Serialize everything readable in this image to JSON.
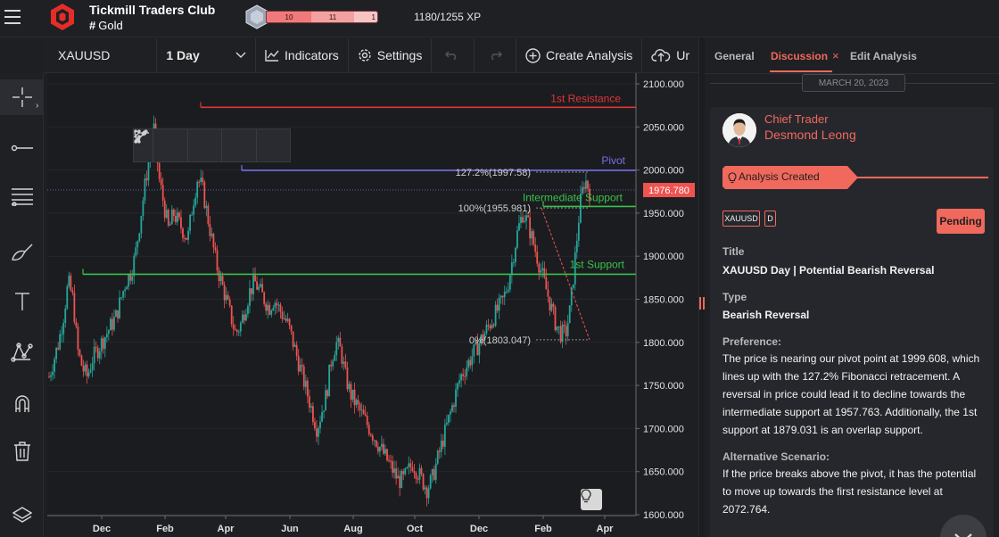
{
  "header": {
    "club_title": "Tickmill Traders Club",
    "club_channel_hash": "#",
    "club_channel": "Gold",
    "level_segments": [
      "10",
      "11",
      "1"
    ],
    "xp": "1180/1255 XP",
    "colors": {
      "accent": "#f0695c",
      "background": "#1f2024"
    }
  },
  "toolbar": {
    "symbol": "XAUUSD",
    "interval": "1 Day",
    "indicators": "Indicators",
    "settings": "Settings",
    "create_analysis": "Create Analysis",
    "upload_partial": "Ur"
  },
  "left_tools": [
    "crosshair-icon",
    "line-tool-icon",
    "fib-tool-icon",
    "brush-icon",
    "text-icon",
    "pattern-icon",
    "magnet-icon",
    "trash-icon",
    "layers-icon"
  ],
  "chart": {
    "current_price": "1976.780",
    "annotations": {
      "resistance": "1st Resistance",
      "pivot": "Pivot",
      "intermediate": "Intermediate Support",
      "support1": "1st Support",
      "fib_127": "127.2%(1997.58)",
      "fib_100": "100%(1955.981)",
      "fib_0": "0%(1803.047)"
    }
  },
  "chart_data": {
    "type": "candlestick",
    "title": "",
    "y_ticks": [
      "2100.000",
      "2050.000",
      "2000.000",
      "1950.000",
      "1900.000",
      "1850.000",
      "1800.000",
      "1750.000",
      "1700.000",
      "1650.000",
      "1600.000"
    ],
    "x_ticks": [
      "Dec",
      "Feb",
      "Apr",
      "Jun",
      "Aug",
      "Oct",
      "Dec",
      "Feb",
      "Apr"
    ],
    "ylim": [
      1600,
      2100
    ],
    "levels": [
      {
        "name": "1st Resistance",
        "value": 2072.764,
        "color": "#e03535"
      },
      {
        "name": "Pivot",
        "value": 1999.608,
        "color": "#7670e8"
      },
      {
        "name": "Intermediate Support",
        "value": 1957.763,
        "color": "#39c24a"
      },
      {
        "name": "1st Support",
        "value": 1879.031,
        "color": "#39c24a"
      }
    ],
    "close_path": [
      1760,
      1780,
      1800,
      1830,
      1870,
      1850,
      1790,
      1770,
      1760,
      1780,
      1790,
      1800,
      1810,
      1820,
      1830,
      1850,
      1870,
      1880,
      1900,
      1940,
      1980,
      2020,
      2050,
      1990,
      1960,
      1930,
      1950,
      1940,
      1930,
      1920,
      1960,
      1990,
      1980,
      1950,
      1920,
      1890,
      1870,
      1850,
      1830,
      1810,
      1820,
      1840,
      1860,
      1870,
      1860,
      1850,
      1840,
      1850,
      1840,
      1830,
      1820,
      1800,
      1780,
      1760,
      1740,
      1720,
      1700,
      1720,
      1740,
      1780,
      1800,
      1790,
      1760,
      1740,
      1730,
      1720,
      1710,
      1700,
      1690,
      1680,
      1670,
      1660,
      1650,
      1640,
      1640,
      1650,
      1660,
      1650,
      1640,
      1630,
      1640,
      1660,
      1680,
      1700,
      1720,
      1740,
      1760,
      1770,
      1780,
      1790,
      1800,
      1810,
      1820,
      1830,
      1840,
      1850,
      1870,
      1900,
      1930,
      1950,
      1940,
      1920,
      1900,
      1880,
      1860,
      1840,
      1820,
      1810,
      1810,
      1840,
      1900,
      1960,
      1990,
      1976
    ]
  },
  "panel": {
    "tabs": [
      "General",
      "Discussion",
      "Edit Analysis"
    ],
    "close": "×",
    "date": "MARCH 20, 2023",
    "author_role": "Chief Trader",
    "author_name": "Desmond Leong",
    "banner": "Analysis Created",
    "tags": [
      "XAUUSD",
      "D"
    ],
    "status": "Pending",
    "title_label": "Title",
    "title_value": "XAUUSD Day | Potential Bearish Reversal",
    "type_label": "Type",
    "type_value": "Bearish Reversal",
    "preference_label": "Preference:",
    "preference_text": "The price is nearing our pivot point at 1999.608, which lines up with the 127.2% Fibonacci retracement. A reversal in price could lead it to decline towards the intermediate support at 1957.763. Additionally, the 1st support at 1879.031 is an overlap support.",
    "alternative_label": "Alternative Scenario:",
    "alternative_text": "If the price breaks above the pivot, it has the potential to move up towards the first resistance level at 2072.764."
  }
}
